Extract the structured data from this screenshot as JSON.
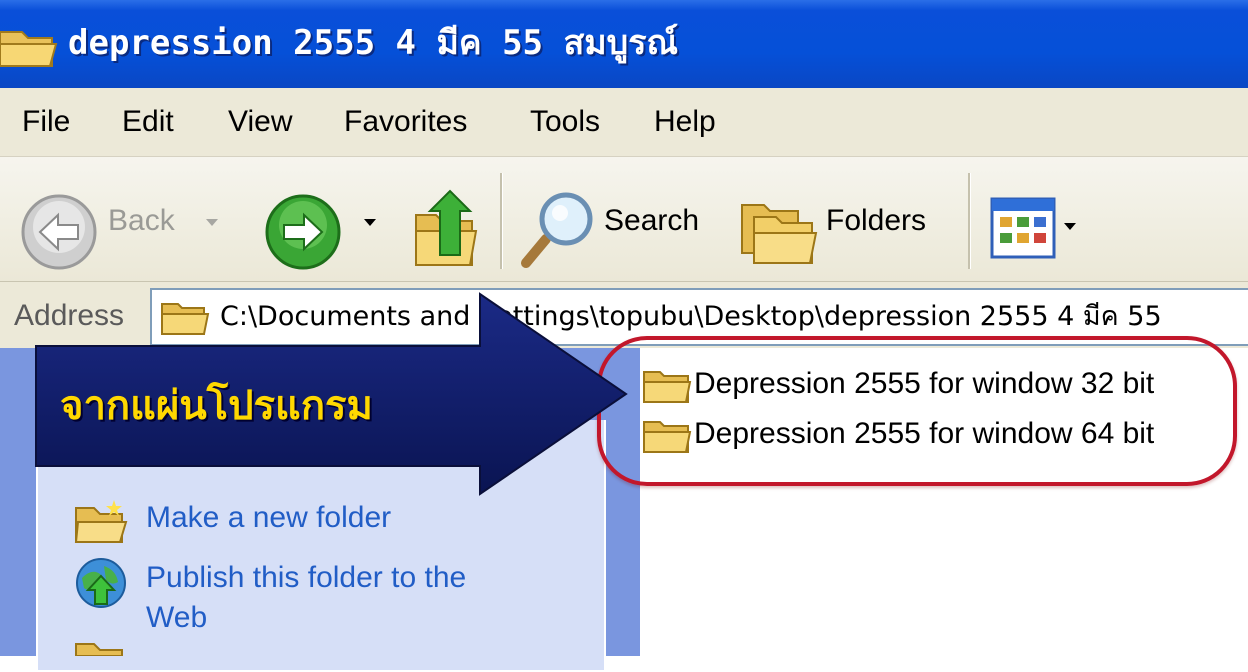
{
  "window": {
    "title": "depression 2555  4 มีค 55 สมบูรณ์",
    "title_icon": "folder-icon"
  },
  "menu": {
    "items": [
      "File",
      "Edit",
      "View",
      "Favorites",
      "Tools",
      "Help"
    ]
  },
  "toolbar": {
    "back_label": "Back",
    "search_label": "Search",
    "folders_label": "Folders",
    "icons": [
      "back-arrow-icon",
      "forward-arrow-icon",
      "up-folder-icon",
      "magnifier-icon",
      "folders-icon",
      "views-icon"
    ]
  },
  "address": {
    "label": "Address",
    "value": "C:\\Documents and Settings\\topubu\\Desktop\\depression 2555  4 มีค 55"
  },
  "tasks": {
    "items": [
      "Make a new folder",
      "Publish this folder to the",
      "Web"
    ]
  },
  "files": {
    "items": [
      "Depression 2555 for window 32 bit",
      "Depression 2555 for window 64 bit"
    ]
  },
  "annotation": {
    "label": "จากแผ่นโปรแกรม",
    "arrow_color": "#0d1a63",
    "highlight_color": "#c2172b"
  },
  "colors": {
    "titlebar": "#0550d8",
    "menubar": "#ece9d8",
    "task_link": "#215dc6",
    "left_pane": "#7a96df"
  }
}
